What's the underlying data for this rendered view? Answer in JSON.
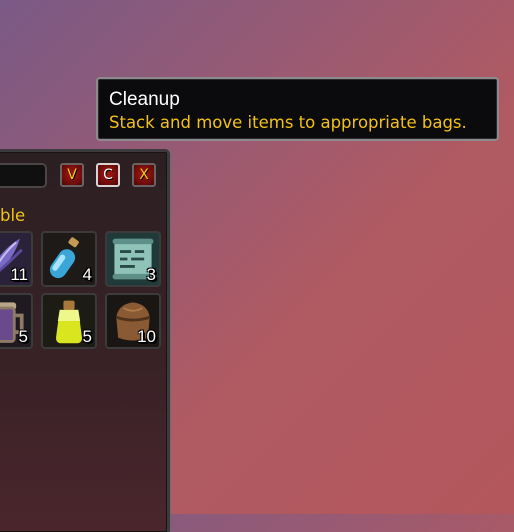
{
  "tooltip": {
    "title": "Cleanup",
    "description": "Stack and move items to appropriate bags."
  },
  "bag": {
    "search": {
      "value": "",
      "placeholder": ""
    },
    "header_buttons": [
      {
        "label": "V",
        "name": "v-button"
      },
      {
        "label": "C",
        "name": "cleanup-button"
      },
      {
        "label": "X",
        "name": "close-button"
      }
    ],
    "category_label": "ble",
    "items": [
      {
        "icon": "feather-quill-icon",
        "count": "11"
      },
      {
        "icon": "blue-potion-icon",
        "count": "4"
      },
      {
        "icon": "scroll-icon",
        "count": "3"
      },
      {
        "icon": "tankard-icon",
        "count": "5"
      },
      {
        "icon": "yellow-potion-icon",
        "count": "5"
      },
      {
        "icon": "leather-pouch-icon",
        "count": "10"
      }
    ]
  },
  "colors": {
    "tooltip_title": "#ffffff",
    "tooltip_desc": "#f2c21a",
    "button_red": "#a41713"
  }
}
